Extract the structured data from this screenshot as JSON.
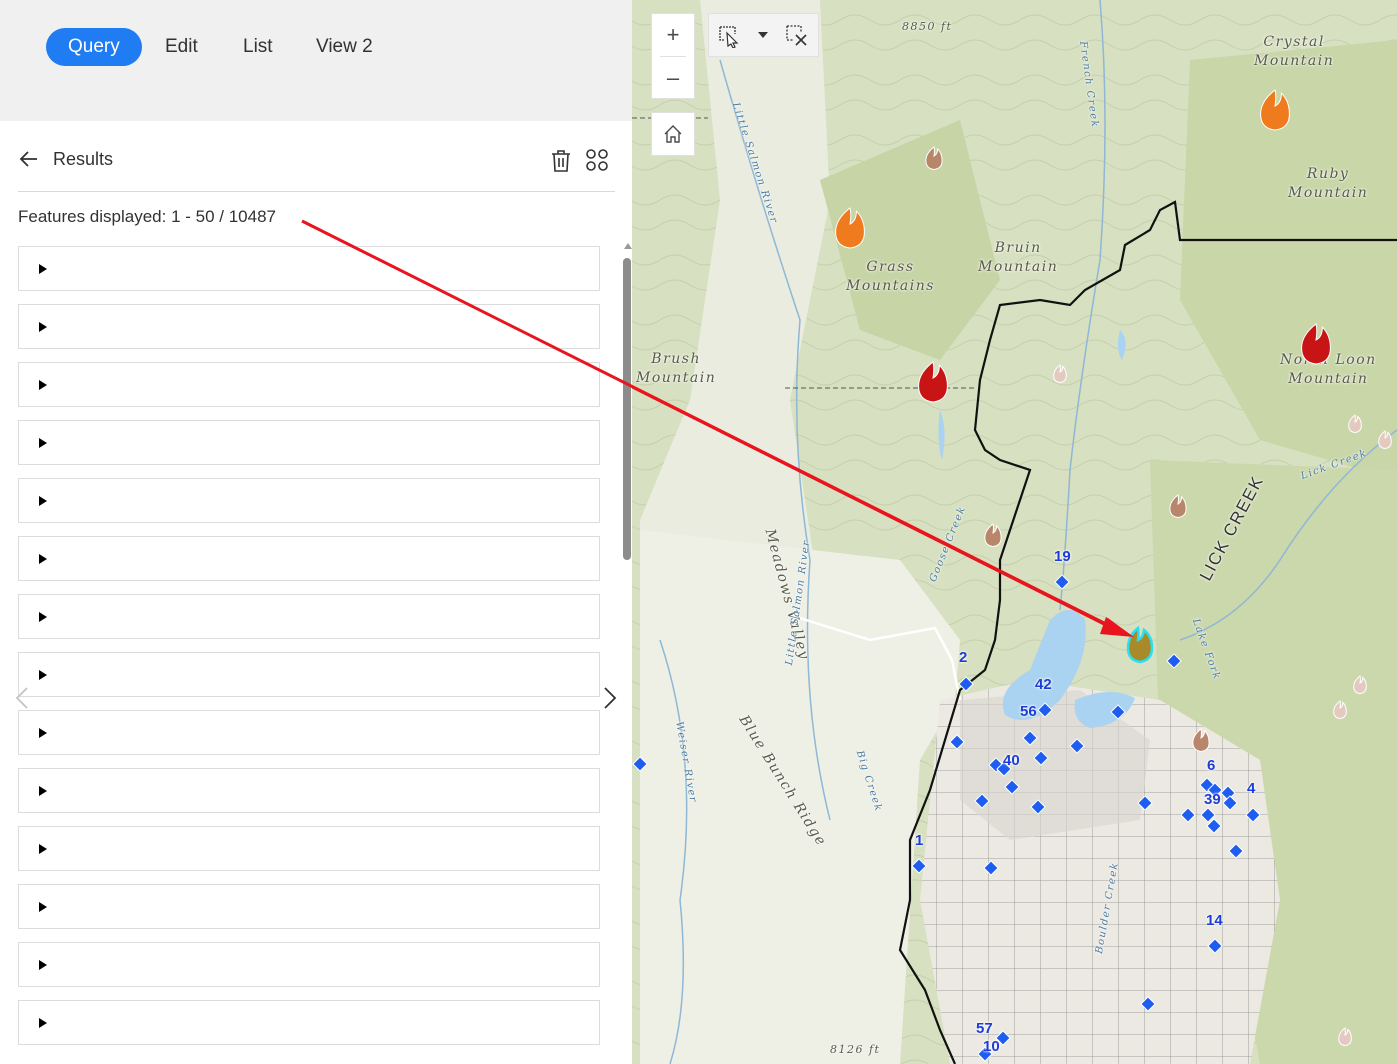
{
  "nav": {
    "tabs": [
      {
        "label": "Query",
        "active": true
      },
      {
        "label": "Edit",
        "active": false
      },
      {
        "label": "List",
        "active": false
      },
      {
        "label": "View 2",
        "active": false
      }
    ]
  },
  "results": {
    "title": "Results",
    "features_text": "Features displayed: 1 - 50 / 10487",
    "row_count_visible": 14,
    "icons": {
      "back": "arrow-left-icon",
      "delete": "trash-icon",
      "layout": "grid-icon",
      "prev": "chevron-left-icon",
      "next": "chevron-right-icon"
    }
  },
  "map": {
    "zoom_in": "+",
    "zoom_out": "–",
    "tools": [
      "zoom-in-icon",
      "zoom-out-icon",
      "home-icon",
      "select-by-pointer-icon",
      "dropdown-caret-icon",
      "clear-selection-icon"
    ],
    "place_labels": {
      "crystal": "Crystal\nMountain",
      "ruby": "Ruby\nMountain",
      "bruin": "Bruin\nMountain",
      "grass": "Grass\nMountains",
      "brush": "Brush\nMountain",
      "north_loon": "North Loon\nMountain",
      "meadows": "Meadows Valley",
      "lick_creek": "LICK CREEK",
      "blue_bunch": "Blue Bunch Ridge",
      "little_salmon": "Little Salmon River",
      "little_salmon_2": "Little Salmon River",
      "french_creek": "French Creek",
      "goose_creek": "Goose Creek",
      "big_creek": "Big Creek",
      "weiser_river": "Weiser River",
      "lake_fork": "Lake Fork",
      "lick_creek_small": "Lick Creek",
      "boulder_creek": "Boulder Creek",
      "elev_8850": "8850 ft",
      "elev_8126": "8126 ft"
    },
    "counts": [
      "19",
      "2",
      "42",
      "56",
      "40",
      "6",
      "4",
      "39",
      "1",
      "14",
      "57",
      "10"
    ],
    "colors": {
      "fire_orange": "#f07a1e",
      "fire_red": "#c81414",
      "fire_brown": "#b8866a",
      "diamond_blue": "#1f5cf0",
      "arrow_red": "#e8141e",
      "boundary": "#1a1a1a",
      "water": "#a9d3f0",
      "selection_cyan": "#27e0f0"
    }
  }
}
